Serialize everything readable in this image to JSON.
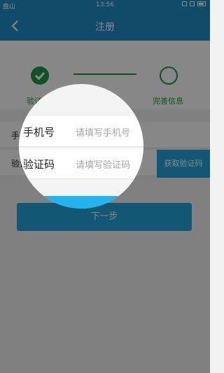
{
  "status_bar": {
    "carrier": "盘山",
    "time": "13:56"
  },
  "nav": {
    "title": "注册",
    "back_icon": "chevron-left-icon"
  },
  "steps": {
    "step1_label": "验证手机",
    "step2_label": "完善信息",
    "active_color": "#1e9b47"
  },
  "form": {
    "phone_label": "手机号",
    "phone_placeholder": "请填写手机号",
    "code_label": "验证码",
    "code_placeholder": "请填写验证码",
    "get_code_button": "获取验证码"
  },
  "next_button": "下一步",
  "colors": {
    "primary": "#1f8fc8",
    "accent": "#22a7dd",
    "success": "#1e9b47"
  }
}
